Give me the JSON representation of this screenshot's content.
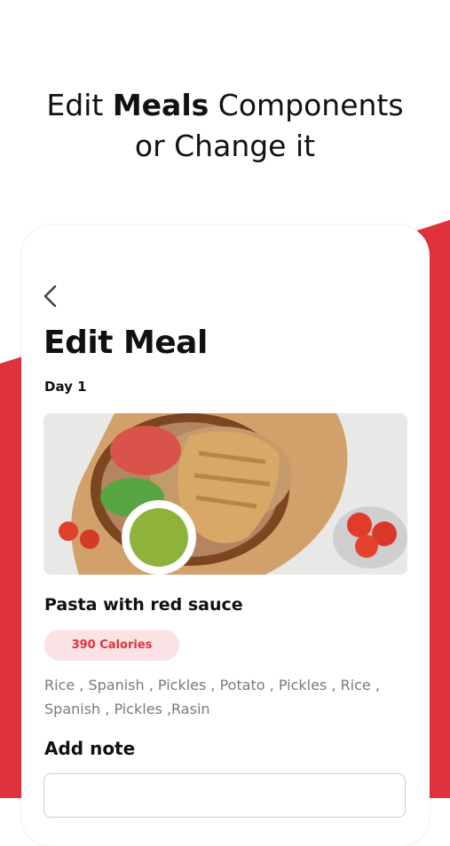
{
  "promo": {
    "line1_prefix": "Edit ",
    "line1_bold": "Meals",
    "line1_suffix": " Components",
    "line2": "or Change it"
  },
  "screen": {
    "title": "Edit Meal",
    "day": "Day 1",
    "meal": {
      "name": "Pasta with red sauce",
      "calories": "390 Calories",
      "ingredients": "Rice , Spanish , Pickles , Potato , Pickles , Rice , Spanish , Pickles ,Rasin"
    },
    "note": {
      "label": "Add note",
      "placeholder": ""
    }
  },
  "colors": {
    "accent": "#e0323c",
    "badge_bg": "#fbe2e4",
    "text": "#111111",
    "muted": "#7a7a7a"
  },
  "icons": {
    "back": "chevron-left-icon"
  }
}
